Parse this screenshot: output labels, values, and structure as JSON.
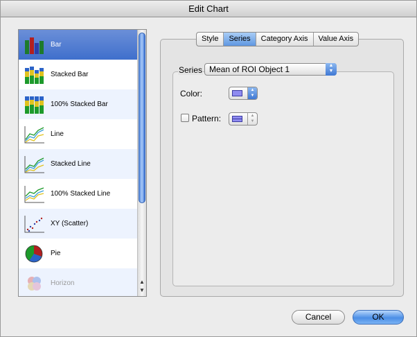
{
  "window": {
    "title": "Edit Chart"
  },
  "chart_types": [
    {
      "label": "Bar",
      "icon": "bar-chart-icon"
    },
    {
      "label": "Stacked Bar",
      "icon": "stacked-bar-chart-icon"
    },
    {
      "label": "100% Stacked Bar",
      "icon": "percent-stacked-bar-chart-icon"
    },
    {
      "label": "Line",
      "icon": "line-chart-icon"
    },
    {
      "label": "Stacked Line",
      "icon": "stacked-line-chart-icon"
    },
    {
      "label": "100% Stacked Line",
      "icon": "percent-stacked-line-chart-icon"
    },
    {
      "label": "XY (Scatter)",
      "icon": "scatter-chart-icon"
    },
    {
      "label": "Pie",
      "icon": "pie-chart-icon"
    },
    {
      "label": "Horizon",
      "icon": "horizon-chart-icon"
    }
  ],
  "tabs": [
    {
      "label": "Style"
    },
    {
      "label": "Series"
    },
    {
      "label": "Category Axis"
    },
    {
      "label": "Value Axis"
    }
  ],
  "series": {
    "label": "Series",
    "selected": "Mean of ROI Object 1",
    "color_label": "Color:",
    "pattern_label": "Pattern:",
    "pattern_checked": false,
    "swatch_color": "#8f8bf0"
  },
  "buttons": {
    "cancel": "Cancel",
    "ok": "OK"
  }
}
